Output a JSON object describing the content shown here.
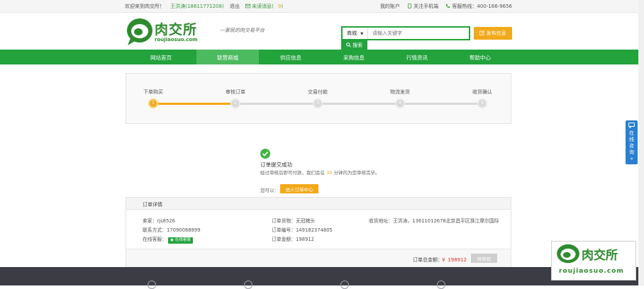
{
  "topbar": {
    "welcome": "欢迎来到肉交所！",
    "user": "王洪涛(18611771208)",
    "logout": "退出",
    "unread": "未读消息(",
    "unread_count": "9",
    "unread_close": ")",
    "my_account": "我的账户",
    "follow_mobile": "关注手机端",
    "hotline": "客服热线：400-166-9656"
  },
  "header": {
    "logo_cn": "肉交所",
    "logo_en": "roujiaosuo.com",
    "slogan": "一家民的肉交易平台",
    "search_scope": "商城",
    "search_placeholder": "请输入关键字",
    "search_button": "搜索",
    "publish_button": "发布信息"
  },
  "nav": [
    {
      "label": "网站首页",
      "active": false
    },
    {
      "label": "联营商城",
      "active": true
    },
    {
      "label": "供应信息",
      "active": false
    },
    {
      "label": "采购信息",
      "active": false
    },
    {
      "label": "行情资讯",
      "active": false
    },
    {
      "label": "帮助中心",
      "active": false
    }
  ],
  "progress": {
    "steps": [
      {
        "label": "下单购买",
        "number": "1",
        "done": true
      },
      {
        "label": "审核订单",
        "number": "2",
        "done": false
      },
      {
        "label": "交易付款",
        "number": "3",
        "done": false
      },
      {
        "label": "物流发货",
        "number": "4",
        "done": false
      },
      {
        "label": "收货确认",
        "number": "5",
        "done": false
      }
    ],
    "completed_fraction": 0.25
  },
  "success": {
    "title": "订单提交成功",
    "desc_pre": "经过审核后即可付款，我们会在",
    "minutes": "30",
    "desc_post": "分钟内为您审核完毕。",
    "can_label": "您可以：",
    "go_button": "进入订单中心"
  },
  "detail": {
    "header": "订单详情",
    "seller": "卖家：rjs8526",
    "contact": "联系方式：17090088899",
    "online_cs_label": "在线客服",
    "online_cs_badge": "在线客服",
    "goods": "订单货物：无冠猪头",
    "order_no": "订单编号：149182374805",
    "amount": "订单金额：198912",
    "address": "收货地址：王洪涛，13611012678北京昌平区珠江摩尔国际",
    "total_label": "订单总金额：",
    "total_value": "￥ 198912",
    "pending_button": "待审核"
  },
  "side_widget": {
    "label": "在线咨询",
    "arrow": "«"
  },
  "watermark": {
    "cn": "肉交所",
    "en": "roujiaosuo.com"
  },
  "colors": {
    "brand_green": "#22a33c",
    "accent_orange": "#f2a91a",
    "price_red": "#d9342b",
    "side_blue": "#2a7fd0"
  }
}
